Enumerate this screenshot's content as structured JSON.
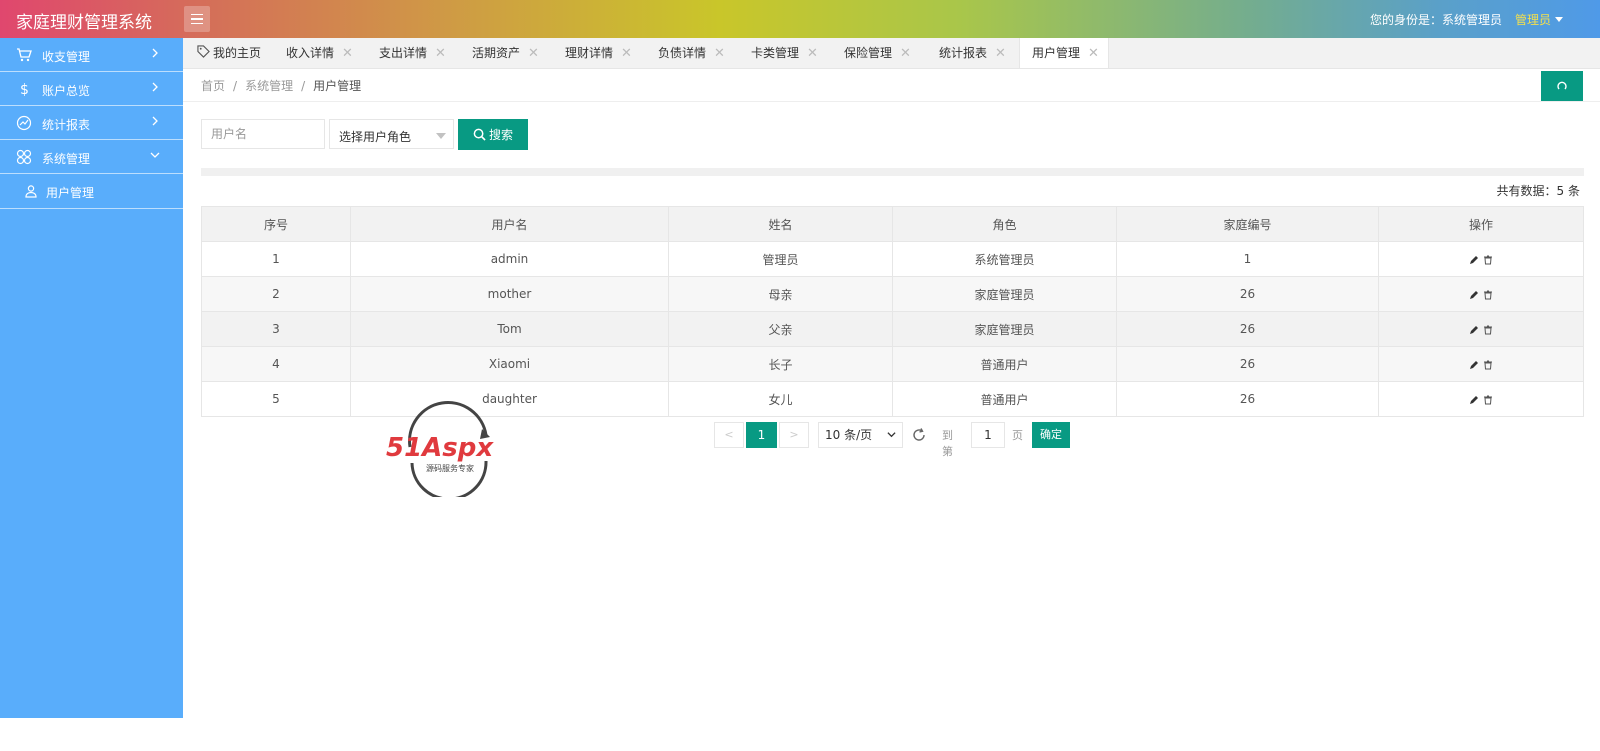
{
  "header": {
    "title": "家庭理财管理系统",
    "identity": "您的身份是：系统管理员",
    "user_name": "管理员"
  },
  "sidebar": {
    "items": [
      {
        "label": "收支管理",
        "icon": "cart-icon"
      },
      {
        "label": "账户总览",
        "icon": "dollar-icon"
      },
      {
        "label": "统计报表",
        "icon": "chart-icon"
      },
      {
        "label": "系统管理",
        "icon": "grid-icon",
        "expanded": true
      }
    ],
    "sub_items": [
      {
        "label": "用户管理",
        "icon": "user-icon"
      }
    ]
  },
  "tabs": [
    {
      "label": "我的主页",
      "closable": false
    },
    {
      "label": "收入详情",
      "closable": true
    },
    {
      "label": "支出详情",
      "closable": true
    },
    {
      "label": "活期资产",
      "closable": true
    },
    {
      "label": "理财详情",
      "closable": true
    },
    {
      "label": "负债详情",
      "closable": true
    },
    {
      "label": "卡类管理",
      "closable": true
    },
    {
      "label": "保险管理",
      "closable": true
    },
    {
      "label": "统计报表",
      "closable": true
    },
    {
      "label": "用户管理",
      "closable": true,
      "active": true
    }
  ],
  "tab_close_glyph": "✕",
  "breadcrumb": {
    "items": [
      "首页",
      "系统管理",
      "用户管理"
    ],
    "separator": "/"
  },
  "search": {
    "username_placeholder": "用户名",
    "role_select_value": "选择用户角色",
    "button_label": "搜索"
  },
  "summary": {
    "total_text": "共有数据：5 条"
  },
  "table": {
    "columns": [
      "序号",
      "用户名",
      "姓名",
      "角色",
      "家庭编号",
      "操作"
    ],
    "rows": [
      [
        "1",
        "admin",
        "管理员",
        "系统管理员",
        "1"
      ],
      [
        "2",
        "mother",
        "母亲",
        "家庭管理员",
        "26"
      ],
      [
        "3",
        "Tom",
        "父亲",
        "家庭管理员",
        "26"
      ],
      [
        "4",
        "Xiaomi",
        "长子",
        "普通用户",
        "26"
      ],
      [
        "5",
        "daughter",
        "女儿",
        "普通用户",
        "26"
      ]
    ]
  },
  "pagination": {
    "prev": "<",
    "next": ">",
    "current_page": "1",
    "page_size": "10 条/页",
    "goto_label": "到第",
    "goto_value": "1",
    "page_label": "页",
    "confirm_label": "确定"
  },
  "watermark": {
    "brand": "51Aspx",
    "tagline": "源码服务专家"
  },
  "colors": {
    "primary": "#089a83",
    "sidebar": "#59adfb",
    "accent_user": "#f4e04d"
  }
}
